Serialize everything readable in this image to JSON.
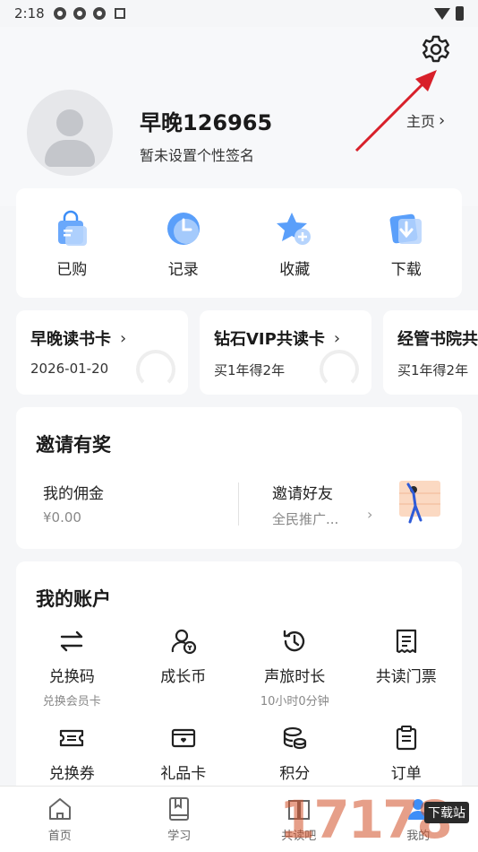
{
  "status_bar": {
    "time": "2:18"
  },
  "profile": {
    "username": "早晚126965",
    "signature": "暂未设置个性签名",
    "home_link": "主页"
  },
  "quick_actions": [
    {
      "label": "已购",
      "icon": "shopping-bag-icon"
    },
    {
      "label": "记录",
      "icon": "clock-icon"
    },
    {
      "label": "收藏",
      "icon": "star-plus-icon"
    },
    {
      "label": "下载",
      "icon": "download-icon"
    }
  ],
  "membership_cards": [
    {
      "title": "早晚读书卡",
      "subtitle": "2026-01-20"
    },
    {
      "title": "钻石VIP共读卡",
      "subtitle": "买1年得2年"
    },
    {
      "title": "经管书院共",
      "subtitle": "买1年得2年"
    }
  ],
  "invite": {
    "title": "邀请有奖",
    "commission_label": "我的佣金",
    "commission_value": "¥0.00",
    "invite_label": "邀请好友",
    "invite_sub": "全民推广..."
  },
  "account": {
    "title": "我的账户",
    "items": [
      {
        "label": "兑换码",
        "sub": "兑换会员卡",
        "icon": "exchange-icon"
      },
      {
        "label": "成长币",
        "sub": "",
        "icon": "growth-coin-icon"
      },
      {
        "label": "声旅时长",
        "sub": "10小时0分钟",
        "icon": "history-icon"
      },
      {
        "label": "共读门票",
        "sub": "",
        "icon": "ticket-icon"
      },
      {
        "label": "兑换券",
        "sub": "",
        "icon": "coupon-icon"
      },
      {
        "label": "礼品卡",
        "sub": "",
        "icon": "gift-card-icon"
      },
      {
        "label": "积分",
        "sub": "",
        "icon": "points-icon"
      },
      {
        "label": "订单",
        "sub": "",
        "icon": "order-icon"
      }
    ]
  },
  "bottom_nav": [
    {
      "label": "首页"
    },
    {
      "label": "学习"
    },
    {
      "label": "共读吧"
    },
    {
      "label": "我的"
    }
  ],
  "watermark": {
    "text": "17178",
    "badge": "下载站"
  },
  "colors": {
    "accent_blue": "#3d8ef7",
    "arrow_red": "#d8202a",
    "page_bg": "#f5f6f8"
  }
}
